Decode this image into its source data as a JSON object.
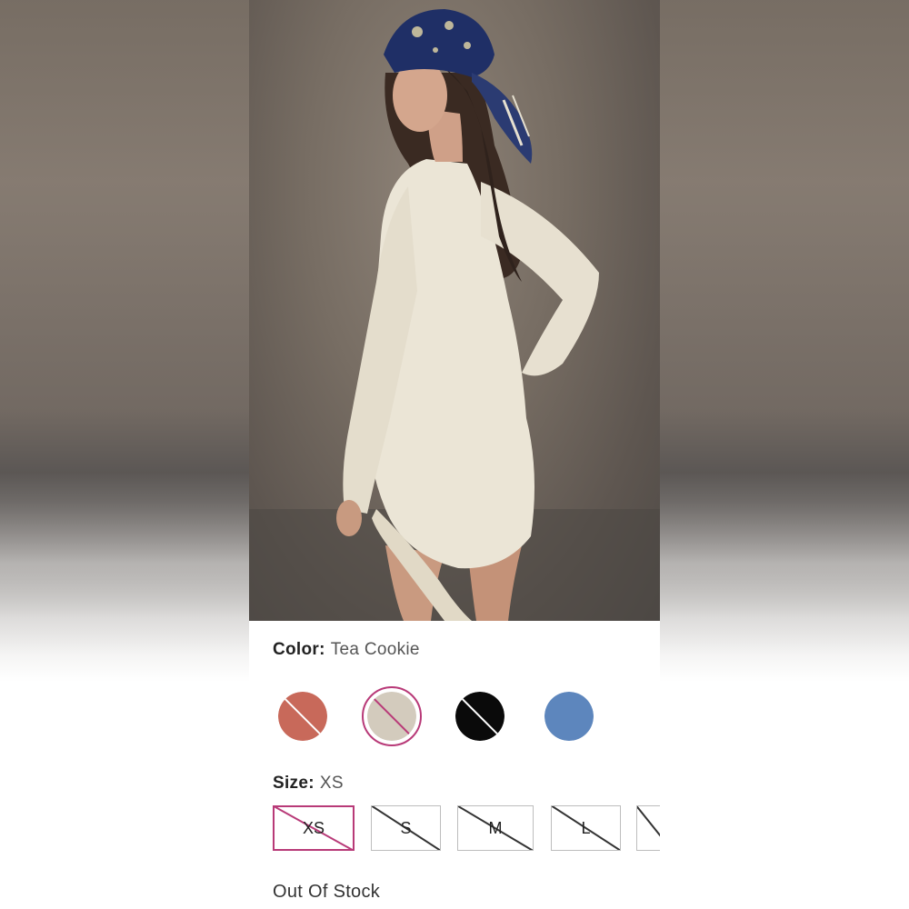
{
  "product": {
    "image_alt": "Model wearing cream long-sleeve knit mini dress with blue bandana"
  },
  "color": {
    "label": "Color:",
    "value": "Tea Cookie",
    "swatches": [
      {
        "name": "rust",
        "hex": "#c8695a",
        "unavailable": true,
        "selected": false
      },
      {
        "name": "tea-cookie",
        "hex": "#d3cbbd",
        "unavailable": true,
        "selected": true
      },
      {
        "name": "black",
        "hex": "#0a0a0a",
        "unavailable": true,
        "selected": false
      },
      {
        "name": "blue",
        "hex": "#5d86bd",
        "unavailable": false,
        "selected": false
      }
    ]
  },
  "size": {
    "label": "Size:",
    "value": "XS",
    "options": [
      {
        "label": "XS",
        "unavailable": true,
        "selected": true
      },
      {
        "label": "S",
        "unavailable": true,
        "selected": false
      },
      {
        "label": "M",
        "unavailable": true,
        "selected": false
      },
      {
        "label": "L",
        "unavailable": true,
        "selected": false
      },
      {
        "label": "",
        "unavailable": true,
        "selected": false
      }
    ]
  },
  "stock_status": "Out Of Stock",
  "colors": {
    "accent": "#b83a78",
    "border": "#bdbdbd",
    "text": "#222222"
  }
}
